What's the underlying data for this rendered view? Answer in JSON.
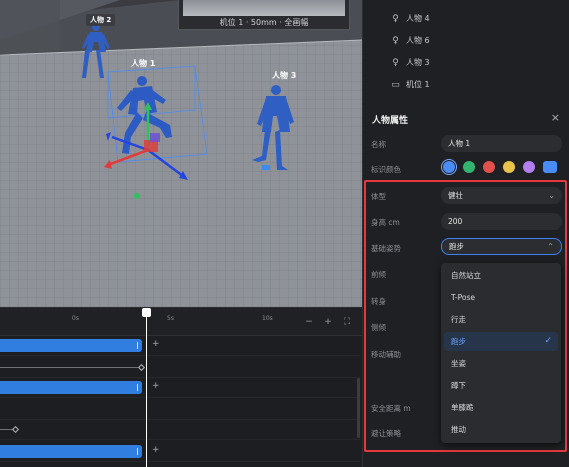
{
  "viewport": {
    "camera_label": "机位 1 · 50mm · 全画幅",
    "characters": [
      {
        "name": "人物 2"
      },
      {
        "name": "人物 1"
      },
      {
        "name": "人物 3"
      }
    ]
  },
  "timeline": {
    "ticks": [
      "0s",
      "5s",
      "10s"
    ],
    "tools": [
      "−",
      "+",
      "⛶"
    ]
  },
  "scene_list": {
    "items": [
      {
        "label": "人物 4",
        "icon": "person-icon"
      },
      {
        "label": "人物 6",
        "icon": "person-icon"
      },
      {
        "label": "人物 3",
        "icon": "person-icon"
      },
      {
        "label": "机位 1",
        "icon": "camera-icon"
      }
    ]
  },
  "attributes": {
    "title": "人物属性",
    "close": "×",
    "name_label": "名称",
    "name_value": "人物 1",
    "color_label": "标识颜色",
    "colors": [
      "#4a8cf7",
      "#33b36f",
      "#e2504d",
      "#e8c24a",
      "#b37ef0",
      "#4a8cf7"
    ],
    "body_type_label": "体型",
    "body_type_value": "健壮",
    "height_label": "身高 cm",
    "height_value": "200",
    "pose_label": "基础姿势",
    "pose_value": "跑步",
    "lean_label": "前倾",
    "turn_label": "转身",
    "side_lean_label": "侧倾",
    "move_assist_label": "移动辅助",
    "safe_distance_label": "安全距离 m",
    "avoid_label": "避让策略"
  },
  "pose_dropdown": {
    "options": [
      "自然站立",
      "T-Pose",
      "行走",
      "跑步",
      "坐姿",
      "蹲下",
      "单膝跪",
      "推动"
    ],
    "selected": "跑步"
  }
}
